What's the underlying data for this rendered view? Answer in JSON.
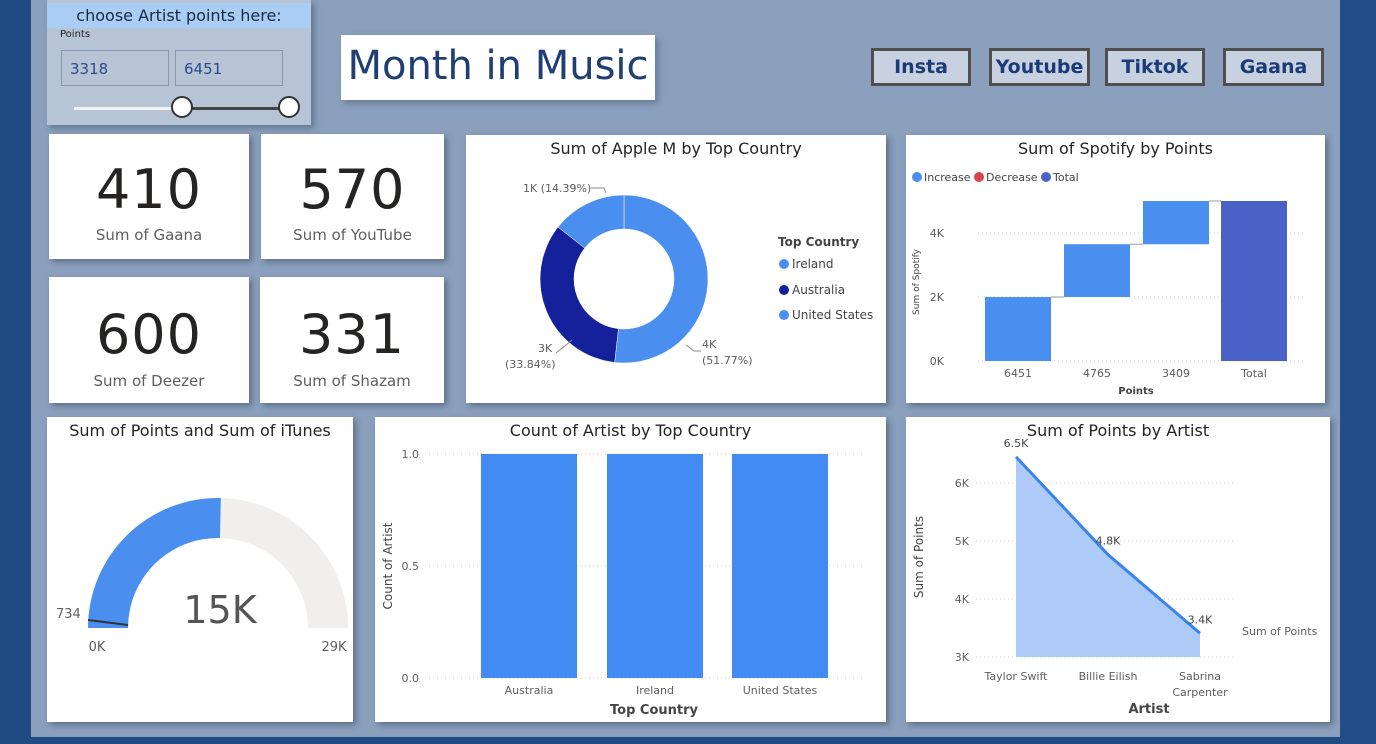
{
  "slicer": {
    "header": "choose Artist points here:",
    "label": "Points",
    "min_value": "3318",
    "max_value": "6451"
  },
  "report_title": "Month in Music",
  "nav_buttons": [
    "Insta",
    "Youtube",
    "Tiktok",
    "Gaana"
  ],
  "kpis": [
    {
      "value": "410",
      "label": "Sum of Gaana"
    },
    {
      "value": "570",
      "label": "Sum of YouTube"
    },
    {
      "value": "600",
      "label": "Sum of Deezer"
    },
    {
      "value": "331",
      "label": "Sum of Shazam"
    }
  ],
  "donut": {
    "title": "Sum of Apple M by Top Country",
    "legend_title": "Top Country",
    "legend": [
      "Ireland",
      "Australia",
      "United States"
    ],
    "labels": {
      "ireland": "1K (14.39%)",
      "australia_1": "3K",
      "australia_2": "(33.84%)",
      "us_1": "4K",
      "us_2": "(51.77%)"
    },
    "colors": {
      "Ireland": "#4a8ff0",
      "Australia": "#14219b",
      "United States": "#4a8ff0"
    }
  },
  "waterfall": {
    "title": "Sum of Spotify by Points",
    "legend": [
      "Increase",
      "Decrease",
      "Total"
    ],
    "ylabel": "Sum of Spotify",
    "xlabel": "Points",
    "yticks": [
      "4K",
      "2K",
      "0K"
    ],
    "categories": [
      "6451",
      "4765",
      "3409",
      "Total"
    ]
  },
  "gauge": {
    "title": "Sum of Points and Sum of iTunes",
    "value_label": "15K",
    "target_label": "734",
    "min_label": "0K",
    "max_label": "29K"
  },
  "bar": {
    "title": "Count of Artist by Top Country",
    "ylabel": "Count of Artist",
    "xlabel": "Top Country",
    "yticks": [
      "1.0",
      "0.5",
      "0.0"
    ]
  },
  "area": {
    "title": "Sum of Points by Artist",
    "ylabel": "Sum of Points",
    "xlabel": "Artist",
    "yticks": [
      "6K",
      "5K",
      "4K",
      "3K"
    ],
    "xticks": [
      "Taylor Swift",
      "Billie Eilish",
      "Sabrina",
      "Carpenter"
    ],
    "data_labels": [
      "6.5K",
      "4.8K",
      "3.4K"
    ],
    "legend": "Sum of Points"
  },
  "chart_data": [
    {
      "type": "pie",
      "title": "Sum of Apple M by Top Country",
      "categories": [
        "United States",
        "Australia",
        "Ireland"
      ],
      "values": [
        51.77,
        33.84,
        14.39
      ],
      "value_labels": [
        "4K",
        "3K",
        "1K"
      ]
    },
    {
      "type": "bar",
      "subtype": "waterfall",
      "title": "Sum of Spotify by Points",
      "categories": [
        "6451",
        "4765",
        "3409",
        "Total"
      ],
      "values": [
        2000,
        1650,
        1350,
        5000
      ],
      "ylim": [
        0,
        5000
      ],
      "xlabel": "Points",
      "ylabel": "Sum of Spotify"
    },
    {
      "type": "bar",
      "subtype": "gauge",
      "title": "Sum of Points and Sum of iTunes",
      "value": 14700,
      "min": 0,
      "max": 29000,
      "target": 734
    },
    {
      "type": "bar",
      "title": "Count of Artist by Top Country",
      "categories": [
        "Australia",
        "Ireland",
        "United States"
      ],
      "values": [
        1,
        1,
        1
      ],
      "ylim": [
        0,
        1
      ],
      "xlabel": "Top Country",
      "ylabel": "Count of Artist"
    },
    {
      "type": "area",
      "title": "Sum of Points by Artist",
      "categories": [
        "Taylor Swift",
        "Billie Eilish",
        "Sabrina Carpenter"
      ],
      "values": [
        6451,
        4765,
        3409
      ],
      "ylim": [
        3000,
        6600
      ],
      "xlabel": "Artist",
      "ylabel": "Sum of Points"
    }
  ]
}
